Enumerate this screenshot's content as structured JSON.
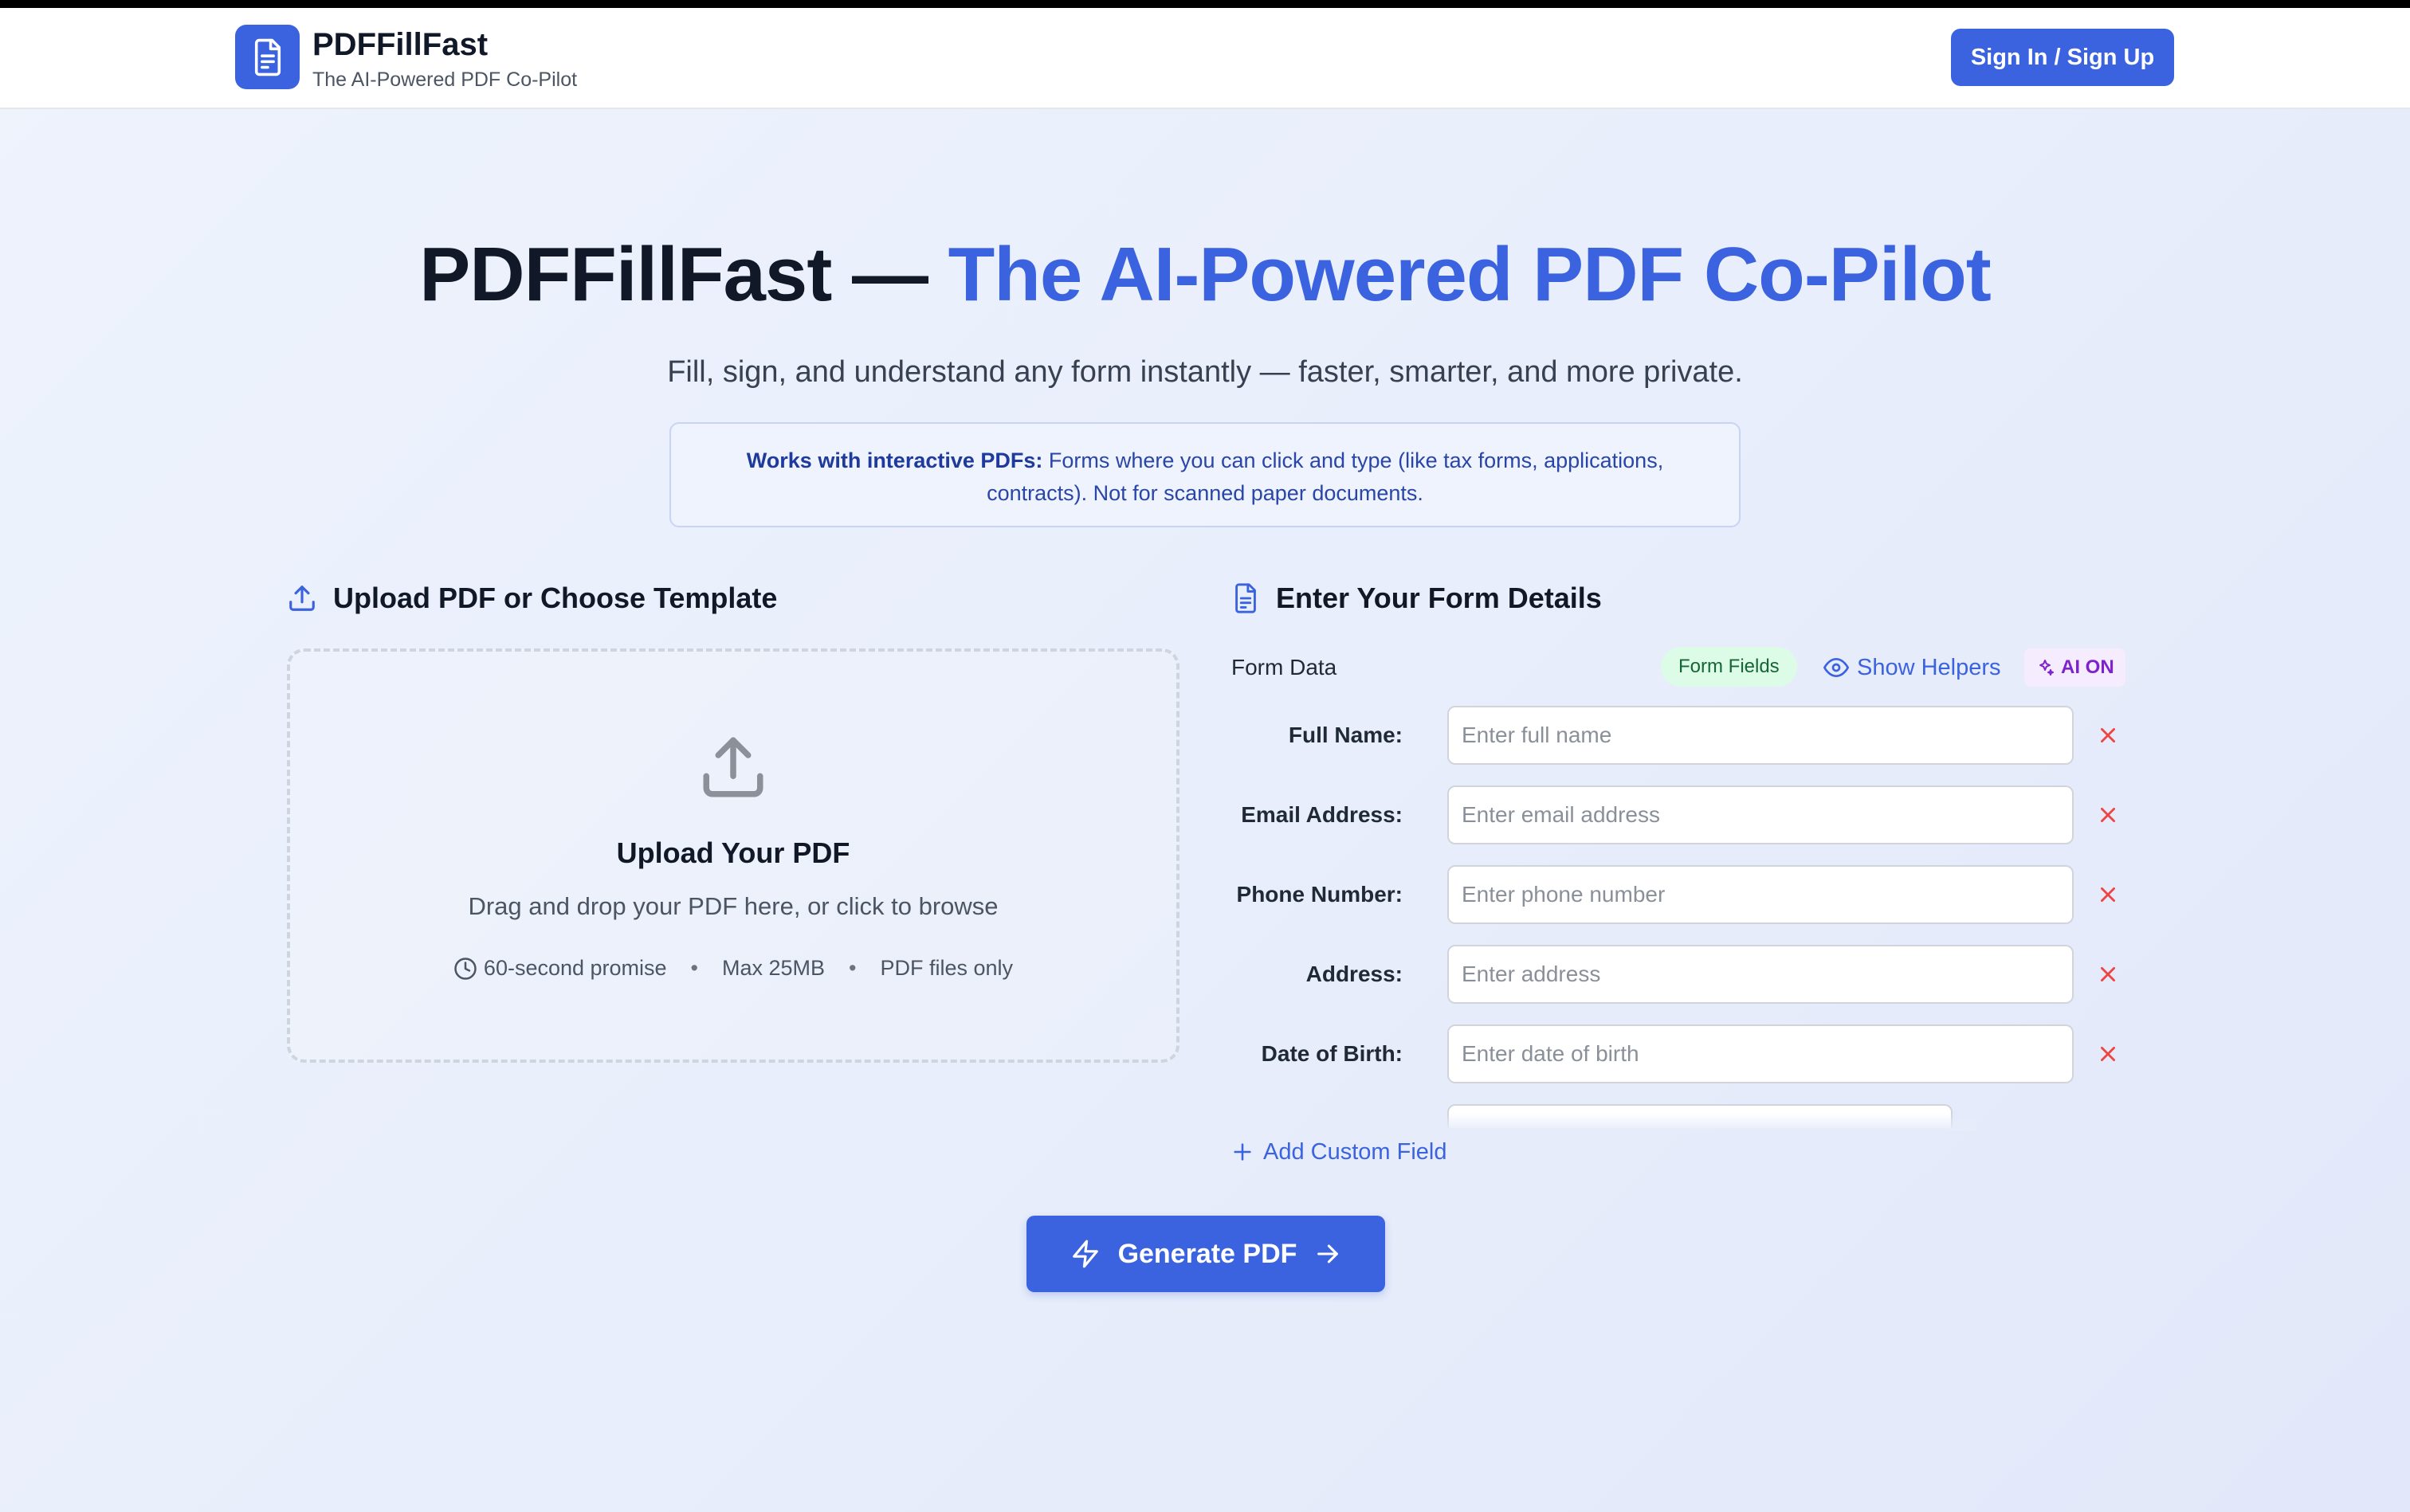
{
  "header": {
    "brand_name": "PDFFillFast",
    "brand_tagline": "The AI-Powered PDF Co-Pilot",
    "sign_in_label": "Sign In / Sign Up",
    "logo_icon": "document-icon"
  },
  "hero": {
    "title_prefix": "PDFFillFast — ",
    "title_accent": "The AI-Powered PDF Co-Pilot",
    "subtitle": "Fill, sign, and understand any form instantly — faster, smarter, and more private.",
    "notice_bold": "Works with interactive PDFs:",
    "notice_text": " Forms where you can click and type (like tax forms, applications, contracts). Not for scanned paper documents."
  },
  "upload": {
    "heading": "Upload PDF or Choose Template",
    "title": "Upload Your PDF",
    "description": "Drag and drop your PDF here, or click to browse",
    "meta": [
      "60-second promise",
      "Max 25MB",
      "PDF files only"
    ]
  },
  "form": {
    "heading": "Enter Your Form Details",
    "form_data_label": "Form Data",
    "badge_form_fields": "Form Fields",
    "show_helpers_label": "Show Helpers",
    "ai_label": "AI ON",
    "fields": [
      {
        "label": "Full Name:",
        "placeholder": "Enter full name",
        "value": ""
      },
      {
        "label": "Email Address:",
        "placeholder": "Enter email address",
        "value": ""
      },
      {
        "label": "Phone Number:",
        "placeholder": "Enter phone number",
        "value": ""
      },
      {
        "label": "Address:",
        "placeholder": "Enter address",
        "value": ""
      },
      {
        "label": "Date of Birth:",
        "placeholder": "Enter date of birth",
        "value": ""
      }
    ],
    "add_field_label": "Add Custom Field"
  },
  "actions": {
    "generate_label": "Generate PDF"
  },
  "colors": {
    "primary": "#3b63e0",
    "remove_red": "#ef4444",
    "badge_green_bg": "#dcfce7",
    "ai_purple": "#7e22ce"
  }
}
